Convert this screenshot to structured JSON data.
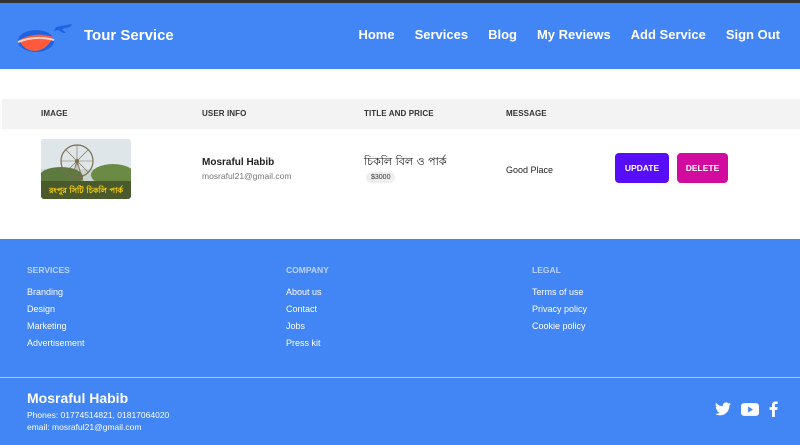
{
  "app": {
    "brand": "Tour Service",
    "accent": "#4285f4"
  },
  "nav": {
    "items": [
      "Home",
      "Services",
      "Blog",
      "My Reviews",
      "Add Service",
      "Sign Out"
    ]
  },
  "table": {
    "headers": [
      "IMAGE",
      "USER INFO",
      "TITLE AND PRICE",
      "MESSAGE"
    ],
    "rows": [
      {
        "user_name": "Mosraful Habib",
        "user_email": "mosraful21@gmail.com",
        "title": "চিকলি বিল ও পার্ক",
        "price": "$3000",
        "message": "Good Place",
        "update_label": "UPDATE",
        "delete_label": "DELETE",
        "thumb_caption": "রংপুর সিটি চিকলি পার্ক"
      }
    ]
  },
  "footer": {
    "columns": [
      {
        "title": "SERVICES",
        "links": [
          "Branding",
          "Design",
          "Marketing",
          "Advertisement"
        ]
      },
      {
        "title": "COMPANY",
        "links": [
          "About us",
          "Contact",
          "Jobs",
          "Press kit"
        ]
      },
      {
        "title": "LEGAL",
        "links": [
          "Terms of use",
          "Privacy policy",
          "Cookie policy"
        ]
      }
    ],
    "owner_name": "Mosraful Habib",
    "phones": "Phones: 01774514821, 01817064020",
    "email": "email: mosraful21@gmail.com",
    "socials": [
      "twitter-icon",
      "youtube-icon",
      "facebook-icon"
    ]
  },
  "colors": {
    "update": "#570df8",
    "delete": "#d10b9d"
  }
}
